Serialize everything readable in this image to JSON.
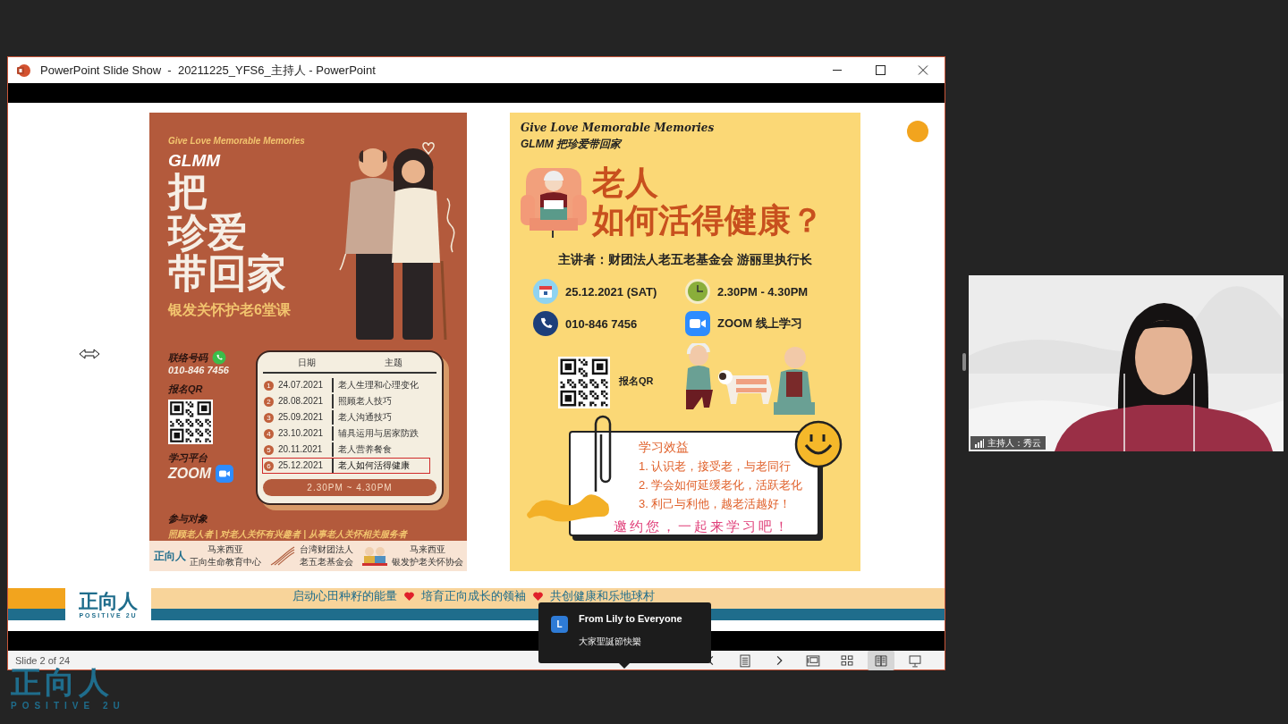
{
  "window": {
    "title": "PowerPoint Slide Show  -  20211225_YFS6_主持人 - PowerPoint"
  },
  "slide": {
    "left_poster": {
      "tagline": "Give Love Memorable Memories",
      "brand": "GLMM",
      "title_lines": [
        "把",
        "珍爱",
        "带回家"
      ],
      "subtitle": "银发关怀护老6堂课",
      "contact_label": "联络号码",
      "phone": "010-846 7456",
      "register_label": "报名QR",
      "platform_label": "学习平台",
      "platform": "ZOOM",
      "schedule": {
        "columns": [
          "日期",
          "主题"
        ],
        "rows": [
          {
            "number": "1",
            "date": "24.07.2021",
            "topic": "老人生理和心理变化",
            "selected": false
          },
          {
            "number": "2",
            "date": "28.08.2021",
            "topic": "照顾老人技巧",
            "selected": false
          },
          {
            "number": "3",
            "date": "25.09.2021",
            "topic": "老人沟通技巧",
            "selected": false
          },
          {
            "number": "4",
            "date": "23.10.2021",
            "topic": "辅具运用与居家防跌",
            "selected": false
          },
          {
            "number": "5",
            "date": "20.11.2021",
            "topic": "老人营养餐食",
            "selected": false
          },
          {
            "number": "6",
            "date": "25.12.2021",
            "topic": "老人如何活得健康",
            "selected": true
          }
        ],
        "time": "2.30PM ~ 4.30PM"
      },
      "audience_label": "参与对象",
      "audience": "照顾老人者 | 对老人关怀有兴趣者 | 从事老人关怀相关服务者",
      "partners": [
        {
          "kind": "wordmark",
          "logo": "正向人",
          "lines": [
            "马来西亚",
            "正向生命教育中心"
          ]
        },
        {
          "kind": "swoosh",
          "lines": [
            "台湾财团法人",
            "老五老基金会"
          ]
        },
        {
          "kind": "elders",
          "lines": [
            "马来西亚",
            "银发护老关怀协会"
          ]
        }
      ]
    },
    "right_poster": {
      "tagline": "Give Love Memorable Memories",
      "brand": "GLMM 把珍爱带回家",
      "title_lines": [
        "老人",
        "如何活得健康？"
      ],
      "speaker": "主讲者：财团法人老五老基金会 游丽里执行长",
      "info": [
        {
          "kind": "date",
          "text": "25.12.2021 (SAT)"
        },
        {
          "kind": "time",
          "text": "2.30PM - 4.30PM"
        },
        {
          "kind": "phone",
          "text": "010-846 7456"
        },
        {
          "kind": "video",
          "text": "ZOOM 线上学习"
        }
      ],
      "register_label": "报名QR",
      "benefits": {
        "title": "学习效益",
        "items": [
          "1. 认识老，接受老，与老同行",
          "2. 学会如何延缓老化，活跃老化",
          "3. 利己与利他，越老活越好！"
        ]
      },
      "invite": "邀约您，一起来学习吧！"
    },
    "banner": {
      "logo": "正向人",
      "wordmark": "POSITIVE 2U",
      "slogans": [
        "启动心田种籽的能量",
        "培育正向成长的领袖",
        "共创健康和乐地球村"
      ]
    }
  },
  "status_bar": {
    "slide_counter": "Slide 2 of 24",
    "buttons": [
      {
        "kind": "previous",
        "selected": false
      },
      {
        "kind": "notes",
        "selected": false
      },
      {
        "kind": "next",
        "selected": false
      },
      {
        "kind": "normal",
        "selected": false
      },
      {
        "kind": "sorter",
        "selected": false
      },
      {
        "kind": "reading",
        "selected": true
      },
      {
        "kind": "slideshow",
        "selected": false
      }
    ]
  },
  "chat_popup": {
    "avatar": "L",
    "header": "From Lily to Everyone",
    "message": "大家聖誕節快樂"
  },
  "video_tile": {
    "name_label": "主持人：秀云"
  },
  "corner_logo": {
    "logo": "正向人",
    "wordmark": "POSITIVE 2U"
  }
}
